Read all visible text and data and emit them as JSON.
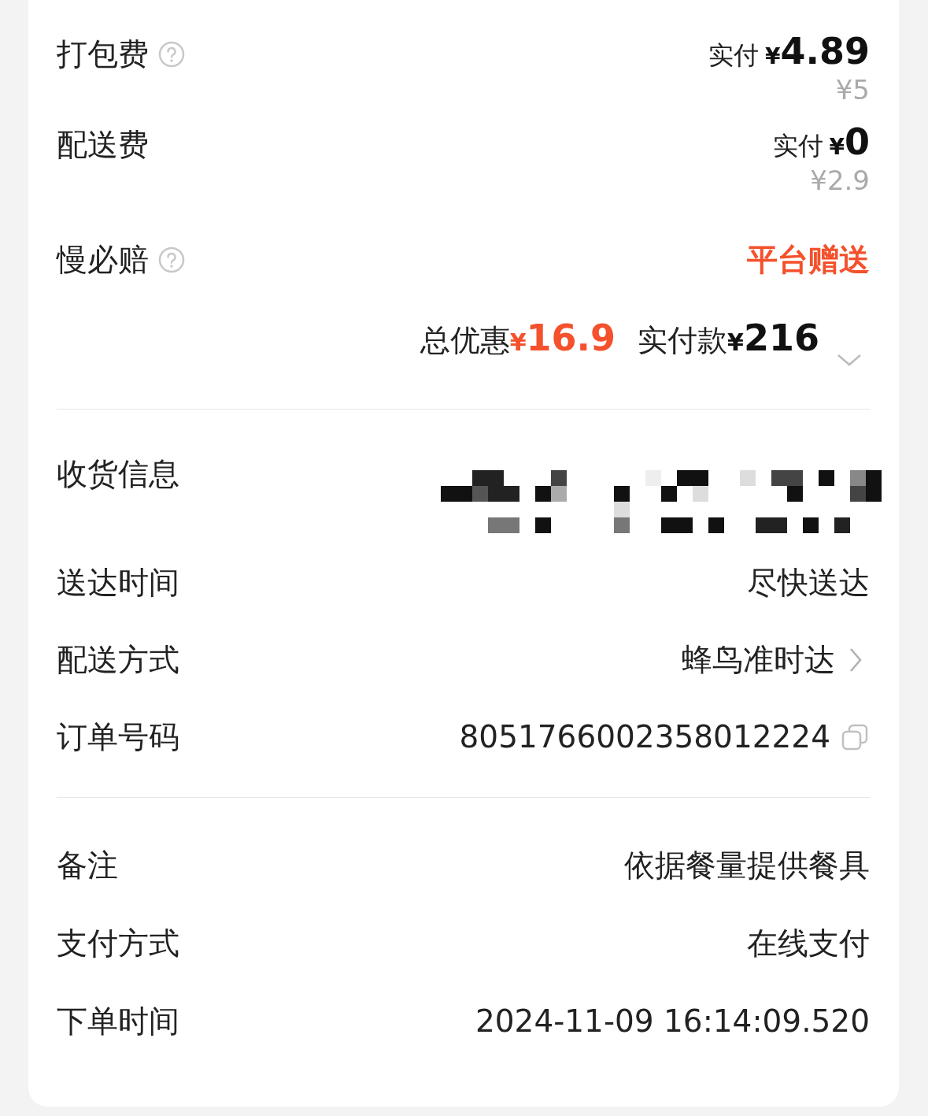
{
  "fees": [
    {
      "label": "打包费",
      "help": true,
      "kind": "price",
      "paid_label": "实付",
      "currency": "¥",
      "paid": "4.89",
      "original": "¥5"
    },
    {
      "label": "配送费",
      "help": false,
      "kind": "price",
      "paid_label": "实付",
      "currency": "¥",
      "paid": "0",
      "original": "¥2.9"
    },
    {
      "label": "慢必赔",
      "help": true,
      "kind": "text",
      "value": "平台赠送"
    }
  ],
  "summary": {
    "discount_label": "总优惠",
    "discount_currency": "¥",
    "discount": "16.9",
    "paid_label": "实付款",
    "paid_currency": "¥",
    "paid": "216",
    "expanded": false
  },
  "address": {
    "label": "收货信息"
  },
  "details": [
    {
      "label": "送达时间",
      "value": "尽快送达",
      "kind": "plain"
    },
    {
      "label": "配送方式",
      "value": "蜂鸟准时达",
      "kind": "link"
    },
    {
      "label": "订单号码",
      "value": "8051766002358012224",
      "kind": "copyable"
    }
  ],
  "extras": [
    {
      "label": "备注",
      "value": "依据餐量提供餐具"
    },
    {
      "label": "支付方式",
      "value": "在线支付"
    },
    {
      "label": "下单时间",
      "value": "2024-11-09 16:14:09.520"
    }
  ]
}
